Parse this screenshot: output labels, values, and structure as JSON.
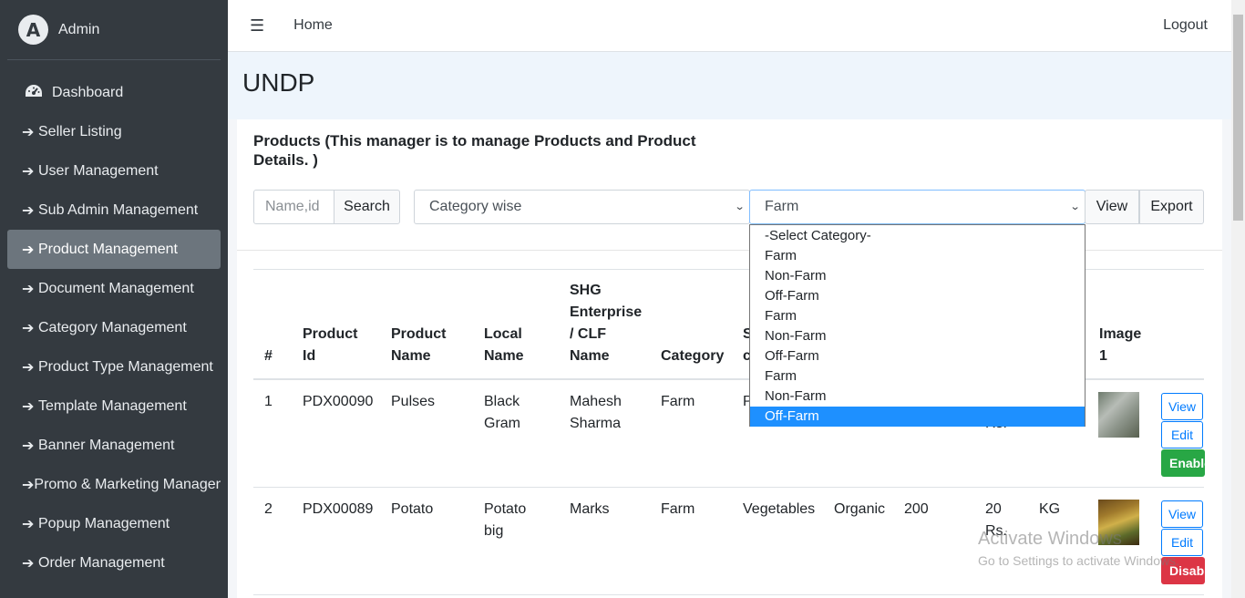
{
  "brand": {
    "logo_letter": "A",
    "name": "Admin"
  },
  "sidebar": {
    "items": [
      {
        "label": "Dashboard",
        "icon": "gauge-icon",
        "active": false
      },
      {
        "label": "Seller Listing",
        "icon": "arrow-right-icon",
        "active": false
      },
      {
        "label": "User Management",
        "icon": "arrow-right-icon",
        "active": false
      },
      {
        "label": "Sub Admin Management",
        "icon": "arrow-right-icon",
        "active": false
      },
      {
        "label": "Product Management",
        "icon": "arrow-right-icon",
        "active": true
      },
      {
        "label": "Document Management",
        "icon": "arrow-right-icon",
        "active": false
      },
      {
        "label": "Category Management",
        "icon": "arrow-right-icon",
        "active": false
      },
      {
        "label": "Product Type Management",
        "icon": "arrow-right-icon",
        "active": false
      },
      {
        "label": "Template Management",
        "icon": "arrow-right-icon",
        "active": false
      },
      {
        "label": "Banner Management",
        "icon": "arrow-right-icon",
        "active": false
      },
      {
        "label": "Promo & Marketing Managen",
        "icon": "arrow-right-icon",
        "active": false
      },
      {
        "label": "Popup Management",
        "icon": "arrow-right-icon",
        "active": false
      },
      {
        "label": "Order Management",
        "icon": "arrow-right-icon",
        "active": false
      }
    ]
  },
  "topbar": {
    "menu_icon": "hamburger-icon",
    "home": "Home",
    "logout": "Logout"
  },
  "page": {
    "title": "UNDP"
  },
  "card": {
    "title": "Products (This manager is to manage Products and Product Details. )",
    "search_placeholder": "Name,id",
    "search_button": "Search",
    "filter_select": "Category wise",
    "category_select": "Farm",
    "view_button": "View",
    "export_button": "Export"
  },
  "dropdown": {
    "options": [
      "-Select Category-",
      "Farm",
      "Non-Farm",
      "Off-Farm",
      "Farm",
      "Non-Farm",
      "Off-Farm",
      "Farm",
      "Non-Farm",
      "Off-Farm"
    ],
    "highlighted": "Off-Farm"
  },
  "table": {
    "headers": {
      "num": "#",
      "product_id": [
        "Product",
        "Id"
      ],
      "product_name": [
        "Product",
        "Name"
      ],
      "local_name": [
        "Local",
        "Name"
      ],
      "shg": [
        "SHG",
        "Enterprise",
        "/ CLF",
        "Name"
      ],
      "category": "Category",
      "subcategory_partial": [
        "S",
        "c"
      ],
      "image": [
        "Image",
        "1"
      ]
    },
    "rows": [
      {
        "num": "1",
        "product_id": "PDX00090",
        "product_name": "Pulses",
        "local_name": [
          "Black",
          "Gram"
        ],
        "shg": [
          "Mahesh",
          "Sharma"
        ],
        "category": "Farm",
        "subcategory_partial": "P",
        "price_partial": "Rs.",
        "actions": {
          "view": "View",
          "edit": "Edit",
          "status": "Enable",
          "status_color": "#28a745"
        }
      },
      {
        "num": "2",
        "product_id": "PDX00089",
        "product_name": "Potato",
        "local_name": [
          "Potato",
          "big"
        ],
        "shg": [
          "Marks"
        ],
        "category": "Farm",
        "subcategory": "Vegetables",
        "type": "Organic",
        "quantity": "200",
        "price": [
          "20",
          "Rs."
        ],
        "unit": "KG",
        "actions": {
          "view": "View",
          "edit": "Edit",
          "status": "Disable",
          "status_color": "#dc3545"
        }
      }
    ]
  },
  "watermark": {
    "line1": "Activate Windows",
    "line2": "Go to Settings to activate Windows."
  }
}
